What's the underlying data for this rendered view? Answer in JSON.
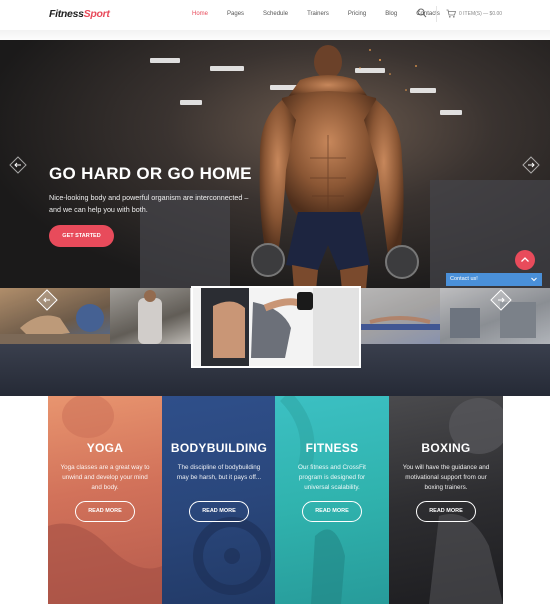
{
  "header": {
    "logo_main": "Fitness",
    "logo_accent": "Sport",
    "nav": [
      "Home",
      "Pages",
      "Schedule",
      "Trainers",
      "Pricing",
      "Blog",
      "Contacts"
    ],
    "cart_text": "0 ITEM(S) — $0.00"
  },
  "hero": {
    "title": "GO HARD OR GO HOME",
    "text": "Nice-looking body and powerful organism are interconnected – and we can help you with both.",
    "button": "GET STARTED"
  },
  "contact_bar": {
    "label": "Contact us!"
  },
  "cards": [
    {
      "title": "YOGA",
      "desc": "Yoga classes are a great way to unwind and develop your mind and body.",
      "button": "READ MORE"
    },
    {
      "title": "BODYBUILDING",
      "desc": "The discipline of bodybuilding may be harsh, but it pays off...",
      "button": "READ MORE"
    },
    {
      "title": "FITNESS",
      "desc": "Our fitness and CrossFit program is designed for universal scalability.",
      "button": "READ MORE"
    },
    {
      "title": "BOXING",
      "desc": "You will have the guidance and motivational support from our boxing trainers.",
      "button": "READ MORE"
    }
  ],
  "colors": {
    "accent": "#e84b5b",
    "contact": "#4a90d9"
  },
  "icons": [
    "search-icon",
    "cart-icon",
    "arrow-left-icon",
    "arrow-right-icon",
    "chevron-up-icon",
    "chevron-down-icon"
  ]
}
